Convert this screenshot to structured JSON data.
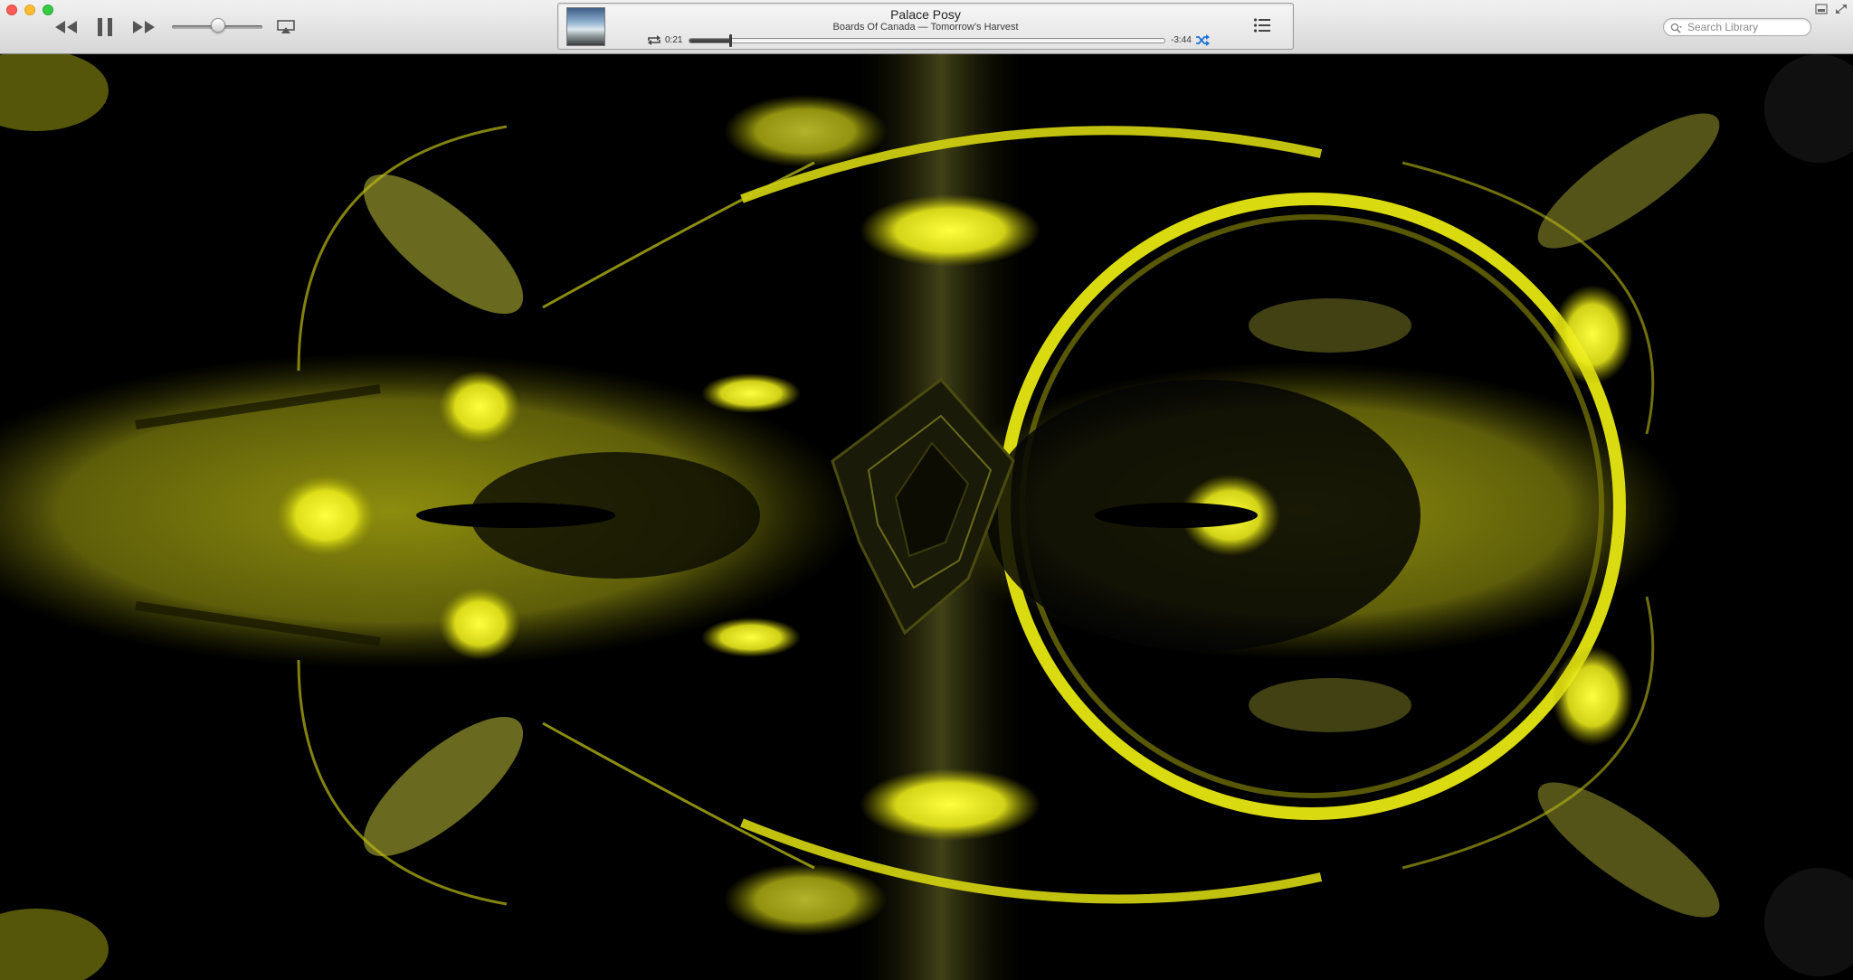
{
  "toolbar": {
    "volume_level": 0.51,
    "icons": {
      "close": "close-traffic-light",
      "minimize": "minimize-traffic-light",
      "zoom": "zoom-traffic-light",
      "rewind": "rewind-icon",
      "pause": "pause-icon",
      "forward": "fast-forward-icon",
      "airplay": "airplay-icon",
      "repeat": "repeat-icon",
      "shuffle": "shuffle-icon",
      "up_next": "list-icon",
      "search": "magnifier-icon",
      "mini_player": "mini-player-icon",
      "full_screen": "full-screen-icon"
    }
  },
  "now_playing": {
    "title": "Palace Posy",
    "subtitle": "Boards Of Canada — Tomorrow’s Harvest",
    "elapsed": "0:21",
    "remaining": "-3:44",
    "progress_fraction": 0.086
  },
  "search": {
    "placeholder": "Search Library",
    "value": ""
  },
  "colors": {
    "shuffle_active": "#1e72d6",
    "visualizer_primary": "#e8e81a",
    "visualizer_background": "#000000"
  }
}
